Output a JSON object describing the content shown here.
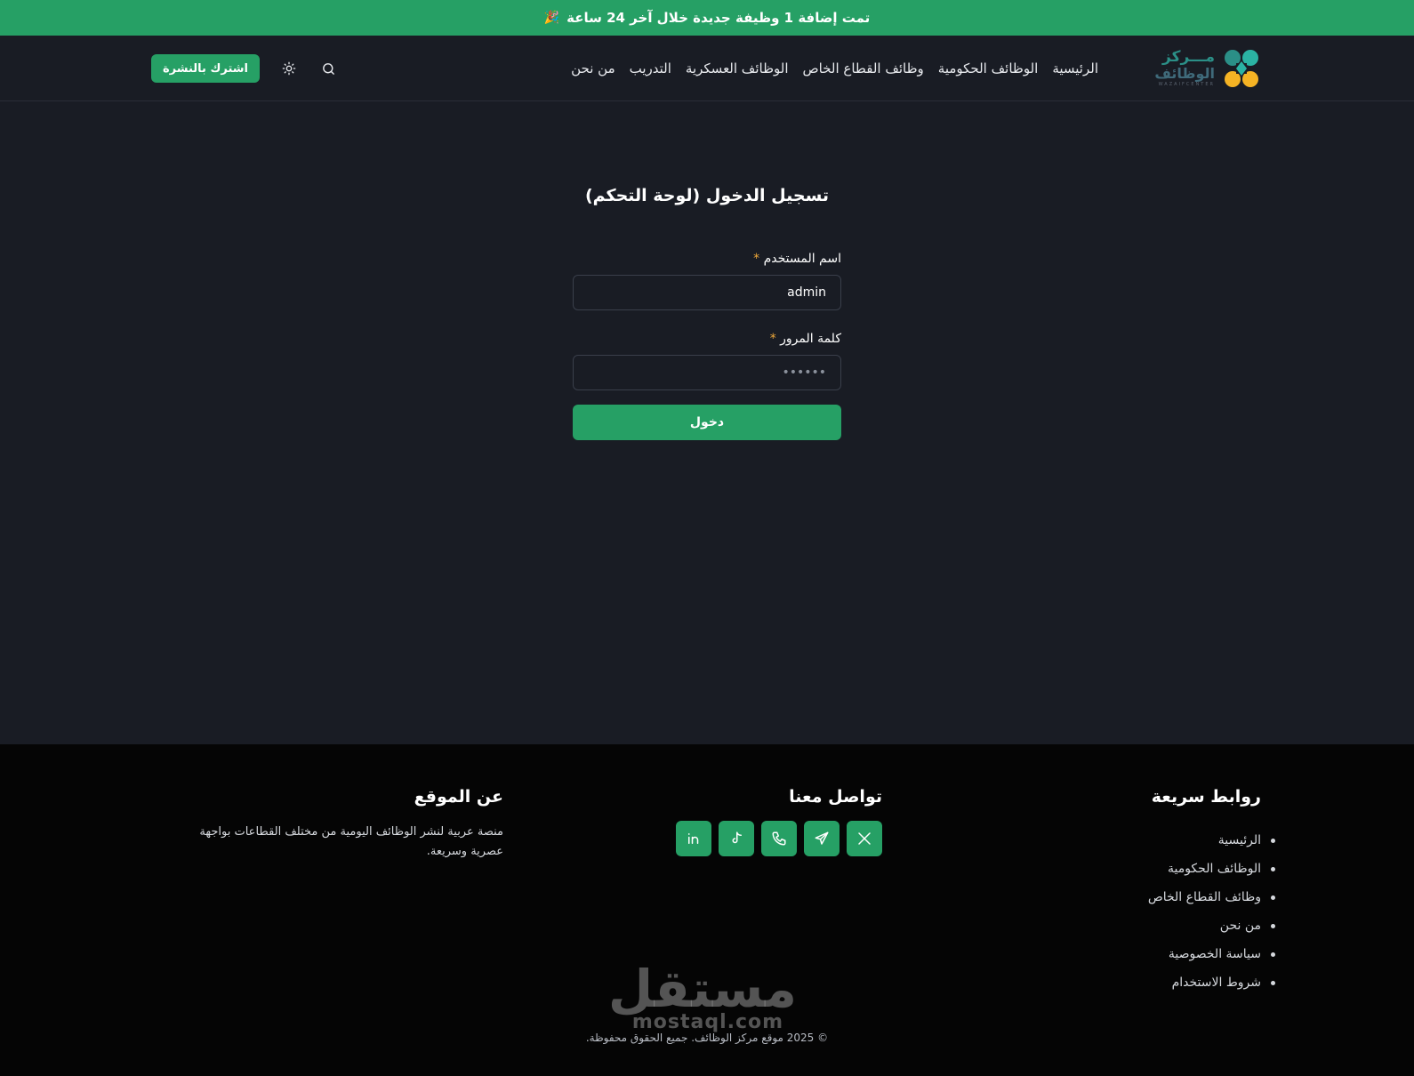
{
  "announcement": {
    "text": "تمت إضافة 1 وظيفة جديدة خلال آخر 24 ساعة",
    "emoji": "🎉"
  },
  "logo": {
    "line1": "مـــركز",
    "line2": "الوظائف",
    "line3": "WAZAIFCENTER"
  },
  "nav": {
    "items": [
      "الرئيسية",
      "الوظائف الحكومية",
      "وظائف القطاع الخاص",
      "الوظائف العسكرية",
      "التدريب",
      "من نحن"
    ]
  },
  "header_tools": {
    "subscribe_label": "اشترك بالنشرة",
    "search_icon": "search-icon",
    "theme_icon": "sun-icon"
  },
  "login": {
    "title": "تسجيل الدخول (لوحة التحكم)",
    "username_label": "اسم المستخدم",
    "username_value": "admin",
    "password_label": "كلمة المرور",
    "password_placeholder": "••••••",
    "required_mark": "*",
    "submit_label": "دخول"
  },
  "footer": {
    "links_title": "روابط سريعة",
    "links": [
      "الرئيسية",
      "الوظائف الحكومية",
      "وظائف القطاع الخاص",
      "من نحن",
      "سياسة الخصوصية",
      "شروط الاستخدام"
    ],
    "contact_title": "تواصل معنا",
    "socials": [
      "x-icon",
      "telegram-icon",
      "phone-icon",
      "tiktok-icon",
      "linkedin-icon"
    ],
    "about_title": "عن الموقع",
    "about_text": "منصة عربية لنشر الوظائف اليومية من مختلف القطاعات بواجهة عصرية وسريعة.",
    "copyright": "© 2025 موقع مركز الوظائف. جميع الحقوق محفوظة.",
    "watermark_ar": "مستقل",
    "watermark_en": "mostaql.com"
  },
  "colors": {
    "accent": "#26a065",
    "background": "#191c24",
    "footer_bg": "#050505",
    "required": "#f0a93a"
  }
}
